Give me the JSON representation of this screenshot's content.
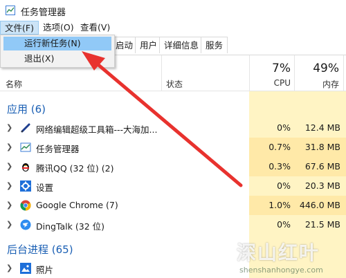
{
  "window": {
    "title": "任务管理器"
  },
  "menu": {
    "file": "文件(F)",
    "options": "选项(O)",
    "view": "查看(V)"
  },
  "dropdown": {
    "run_new_task": "运行新任务(N)",
    "exit": "退出(X)"
  },
  "tabs": {
    "startup": "启动",
    "users": "用户",
    "details": "详细信息",
    "services": "服务"
  },
  "columns": {
    "name": "名称",
    "status": "状态",
    "cpu_pct": "7%",
    "cpu": "CPU",
    "mem_pct": "49%",
    "mem": "内存"
  },
  "groups": {
    "apps": "应用 (6)",
    "background": "后台进程 (65)"
  },
  "apps": [
    {
      "name": "网络编辑超级工具箱---大海加...",
      "cpu": "0%",
      "mem": "12.4 MB",
      "icon": "pen-icon"
    },
    {
      "name": "任务管理器",
      "cpu": "0.7%",
      "mem": "31.8 MB",
      "icon": "task-manager-icon"
    },
    {
      "name": "腾讯QQ (32 位) (2)",
      "cpu": "0.3%",
      "mem": "67.6 MB",
      "icon": "qq-penguin-icon"
    },
    {
      "name": "设置",
      "cpu": "0%",
      "mem": "20.3 MB",
      "icon": "settings-gear-icon"
    },
    {
      "name": "Google Chrome (7)",
      "cpu": "1.0%",
      "mem": "446.0 MB",
      "icon": "chrome-icon"
    },
    {
      "name": "DingTalk (32 位)",
      "cpu": "0%",
      "mem": "21.5 MB",
      "icon": "dingtalk-icon"
    }
  ],
  "background": [
    {
      "name": "照片",
      "icon": "photos-icon"
    }
  ],
  "watermark": {
    "main": "深山红叶",
    "url": "shenshanhongye.com"
  },
  "colors": {
    "accent": "#1a5fb4",
    "highlight": "#91c9f7",
    "arrow": "#e8322e",
    "cpu_tint": "#fff4c4"
  }
}
